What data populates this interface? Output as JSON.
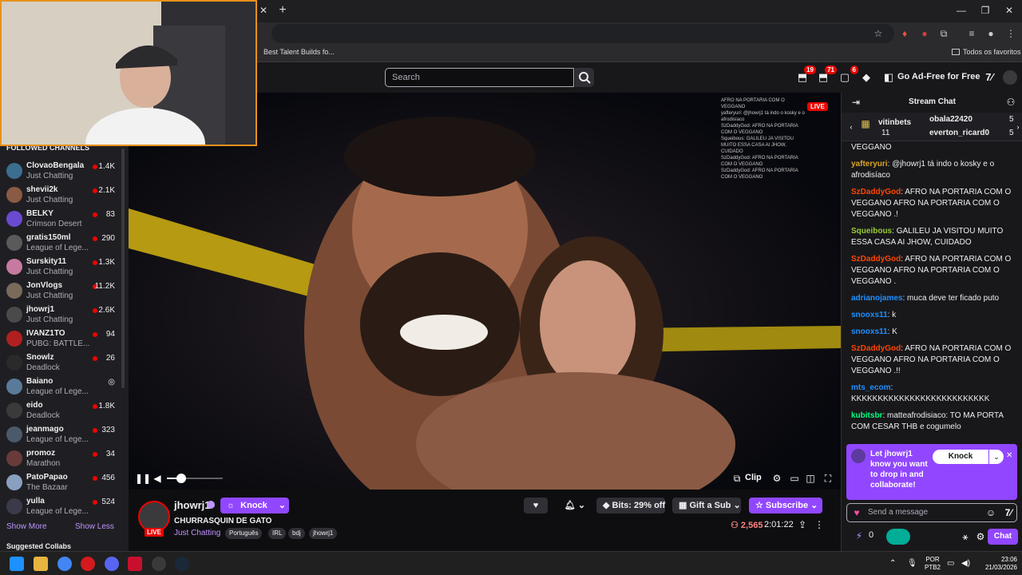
{
  "browser": {
    "bookmark_1": "Best Talent Builds fo...",
    "bookmark_folder": "Todos os favoritos"
  },
  "nav": {
    "search_placeholder": "Search",
    "badges": {
      "inbox": "19",
      "notifications": "71",
      "whispers": "6"
    },
    "ad_free": "Go Ad-Free for Free"
  },
  "sidebar": {
    "title": "Followed Channels",
    "channels": [
      {
        "name": "ClovaoBengala",
        "game": "Just Chatting",
        "viewers": "1.4K",
        "color": "#3b6e8f"
      },
      {
        "name": "shevii2k",
        "game": "Just Chatting",
        "viewers": "2.1K",
        "color": "#8a5a44"
      },
      {
        "name": "BELKY",
        "game": "Crimson Desert",
        "viewers": "83",
        "color": "#6a4ad0"
      },
      {
        "name": "gratis150ml",
        "game": "League of Lege...",
        "viewers": "290",
        "color": "#5a5a5a"
      },
      {
        "name": "Surskity11",
        "game": "Just Chatting",
        "viewers": "1.3K",
        "color": "#c77aa0"
      },
      {
        "name": "JonVlogs",
        "game": "Just Chatting",
        "viewers": "11.2K",
        "color": "#7a6a5a"
      },
      {
        "name": "jhowrj1",
        "game": "Just Chatting",
        "viewers": "2.6K",
        "color": "#4a4a4a"
      },
      {
        "name": "IVANZ1TO",
        "game": "PUBG: BATTLE...",
        "viewers": "94",
        "color": "#b02020"
      },
      {
        "name": "Snowlz",
        "game": "Deadlock",
        "viewers": "26",
        "color": "#2a2a2a"
      },
      {
        "name": "Baiano",
        "game": "League of Lege...",
        "viewers": "",
        "color": "#5a7a9a"
      },
      {
        "name": "eido",
        "game": "Deadlock",
        "viewers": "1.8K",
        "color": "#3a3a3a"
      },
      {
        "name": "jeanmago",
        "game": "League of Lege...",
        "viewers": "323",
        "color": "#4a5a6a"
      },
      {
        "name": "promoz",
        "game": "Marathon",
        "viewers": "34",
        "color": "#6a3a3a"
      },
      {
        "name": "PatoPapao",
        "game": "The Bazaar",
        "viewers": "456",
        "color": "#8aa0c0"
      },
      {
        "name": "yulla",
        "game": "League of Lege...",
        "viewers": "524",
        "color": "#3a3a4a"
      }
    ],
    "show_more": "Show More",
    "show_less": "Show Less",
    "suggested": "Suggested Collabs"
  },
  "video": {
    "live": "LIVE",
    "clip": "Clip",
    "volume_level": 0.25,
    "overlay_chat": [
      "AFRO NA PORTARIA COM O VEGGANO",
      "yafteryuri: @jhowrj1 tá indo o kosky e o afrodisíaco",
      "SzDaddyGod: AFRO NA PORTARIA COM O VEGGANO",
      "Squeibous: GALILEU JA VISITOU MUITO ESSA CASA AI JHOW, CUIDADO",
      "SzDaddyGod: AFRO NA PORTARIA COM O VEGGANO",
      "SzDaddyGod: AFRO NA PORTARIA COM O VEGGANO"
    ]
  },
  "channel": {
    "name": "jhowrj1",
    "live": "LIVE",
    "knock": "Knock",
    "title": "CHURRASQUIN DE GATO",
    "category": "Just Chatting",
    "tags": [
      "Português",
      "IRL",
      "bdj",
      "jhowrj1"
    ],
    "bits": "Bits: 29% off",
    "gift": "Gift a Sub",
    "subscribe": "Subscribe",
    "viewers": "2,565",
    "uptime": "2:01:22"
  },
  "chat": {
    "title": "Stream Chat",
    "gifters": [
      {
        "name": "vitinbets",
        "count": "11"
      },
      {
        "name": "obala22420",
        "count": "5"
      },
      {
        "name": "everton_ricard0",
        "count": "5"
      }
    ],
    "messages": [
      {
        "user": "",
        "color": "#efeff1",
        "text": "VEGGANO"
      },
      {
        "user": "yafteryuri",
        "color": "#daa520",
        "text": "@jhowrj1 tá indo o kosky e o afrodisíaco"
      },
      {
        "user": "SzDaddyGod",
        "color": "#ff4500",
        "text": "AFRO NA PORTARIA COM O VEGGANO AFRO NA PORTARIA COM O VEGGANO .!"
      },
      {
        "user": "Squeibous",
        "color": "#9acd32",
        "text": "GALILEU JA VISITOU MUITO ESSA CASA AI JHOW, CUIDADO"
      },
      {
        "user": "SzDaddyGod",
        "color": "#ff4500",
        "text": "AFRO NA PORTARIA COM O VEGGANO AFRO NA PORTARIA COM O VEGGANO ."
      },
      {
        "user": "adrianojames",
        "color": "#1e90ff",
        "text": "muca deve ter ficado puto"
      },
      {
        "user": "snooxs11",
        "color": "#1e90ff",
        "text": "k"
      },
      {
        "user": "snooxs11",
        "color": "#1e90ff",
        "text": "K"
      },
      {
        "user": "SzDaddyGod",
        "color": "#ff4500",
        "text": "AFRO NA PORTARIA COM O VEGGANO AFRO NA PORTARIA COM O VEGGANO .!!"
      },
      {
        "user": "mts_ecom",
        "color": "#1e90ff",
        "text": "KKKKKKKKKKKKKKKKKKKKKKKKKK"
      },
      {
        "user": "kubitsbr",
        "color": "#00ff7f",
        "text": "matteafrodisiaco: TO MA PORTA COM CESAR THB e cogumelo"
      }
    ],
    "collab_text": "Let jhowrj1 know you want to drop in and collaborate!",
    "collab_knock": "Knock",
    "send_placeholder": "Send a message",
    "points": "0",
    "chat_button": "Chat"
  },
  "taskbar": {
    "lang": "POR",
    "layout": "PTB2",
    "time": "23:06",
    "date": "21/03/2026"
  }
}
